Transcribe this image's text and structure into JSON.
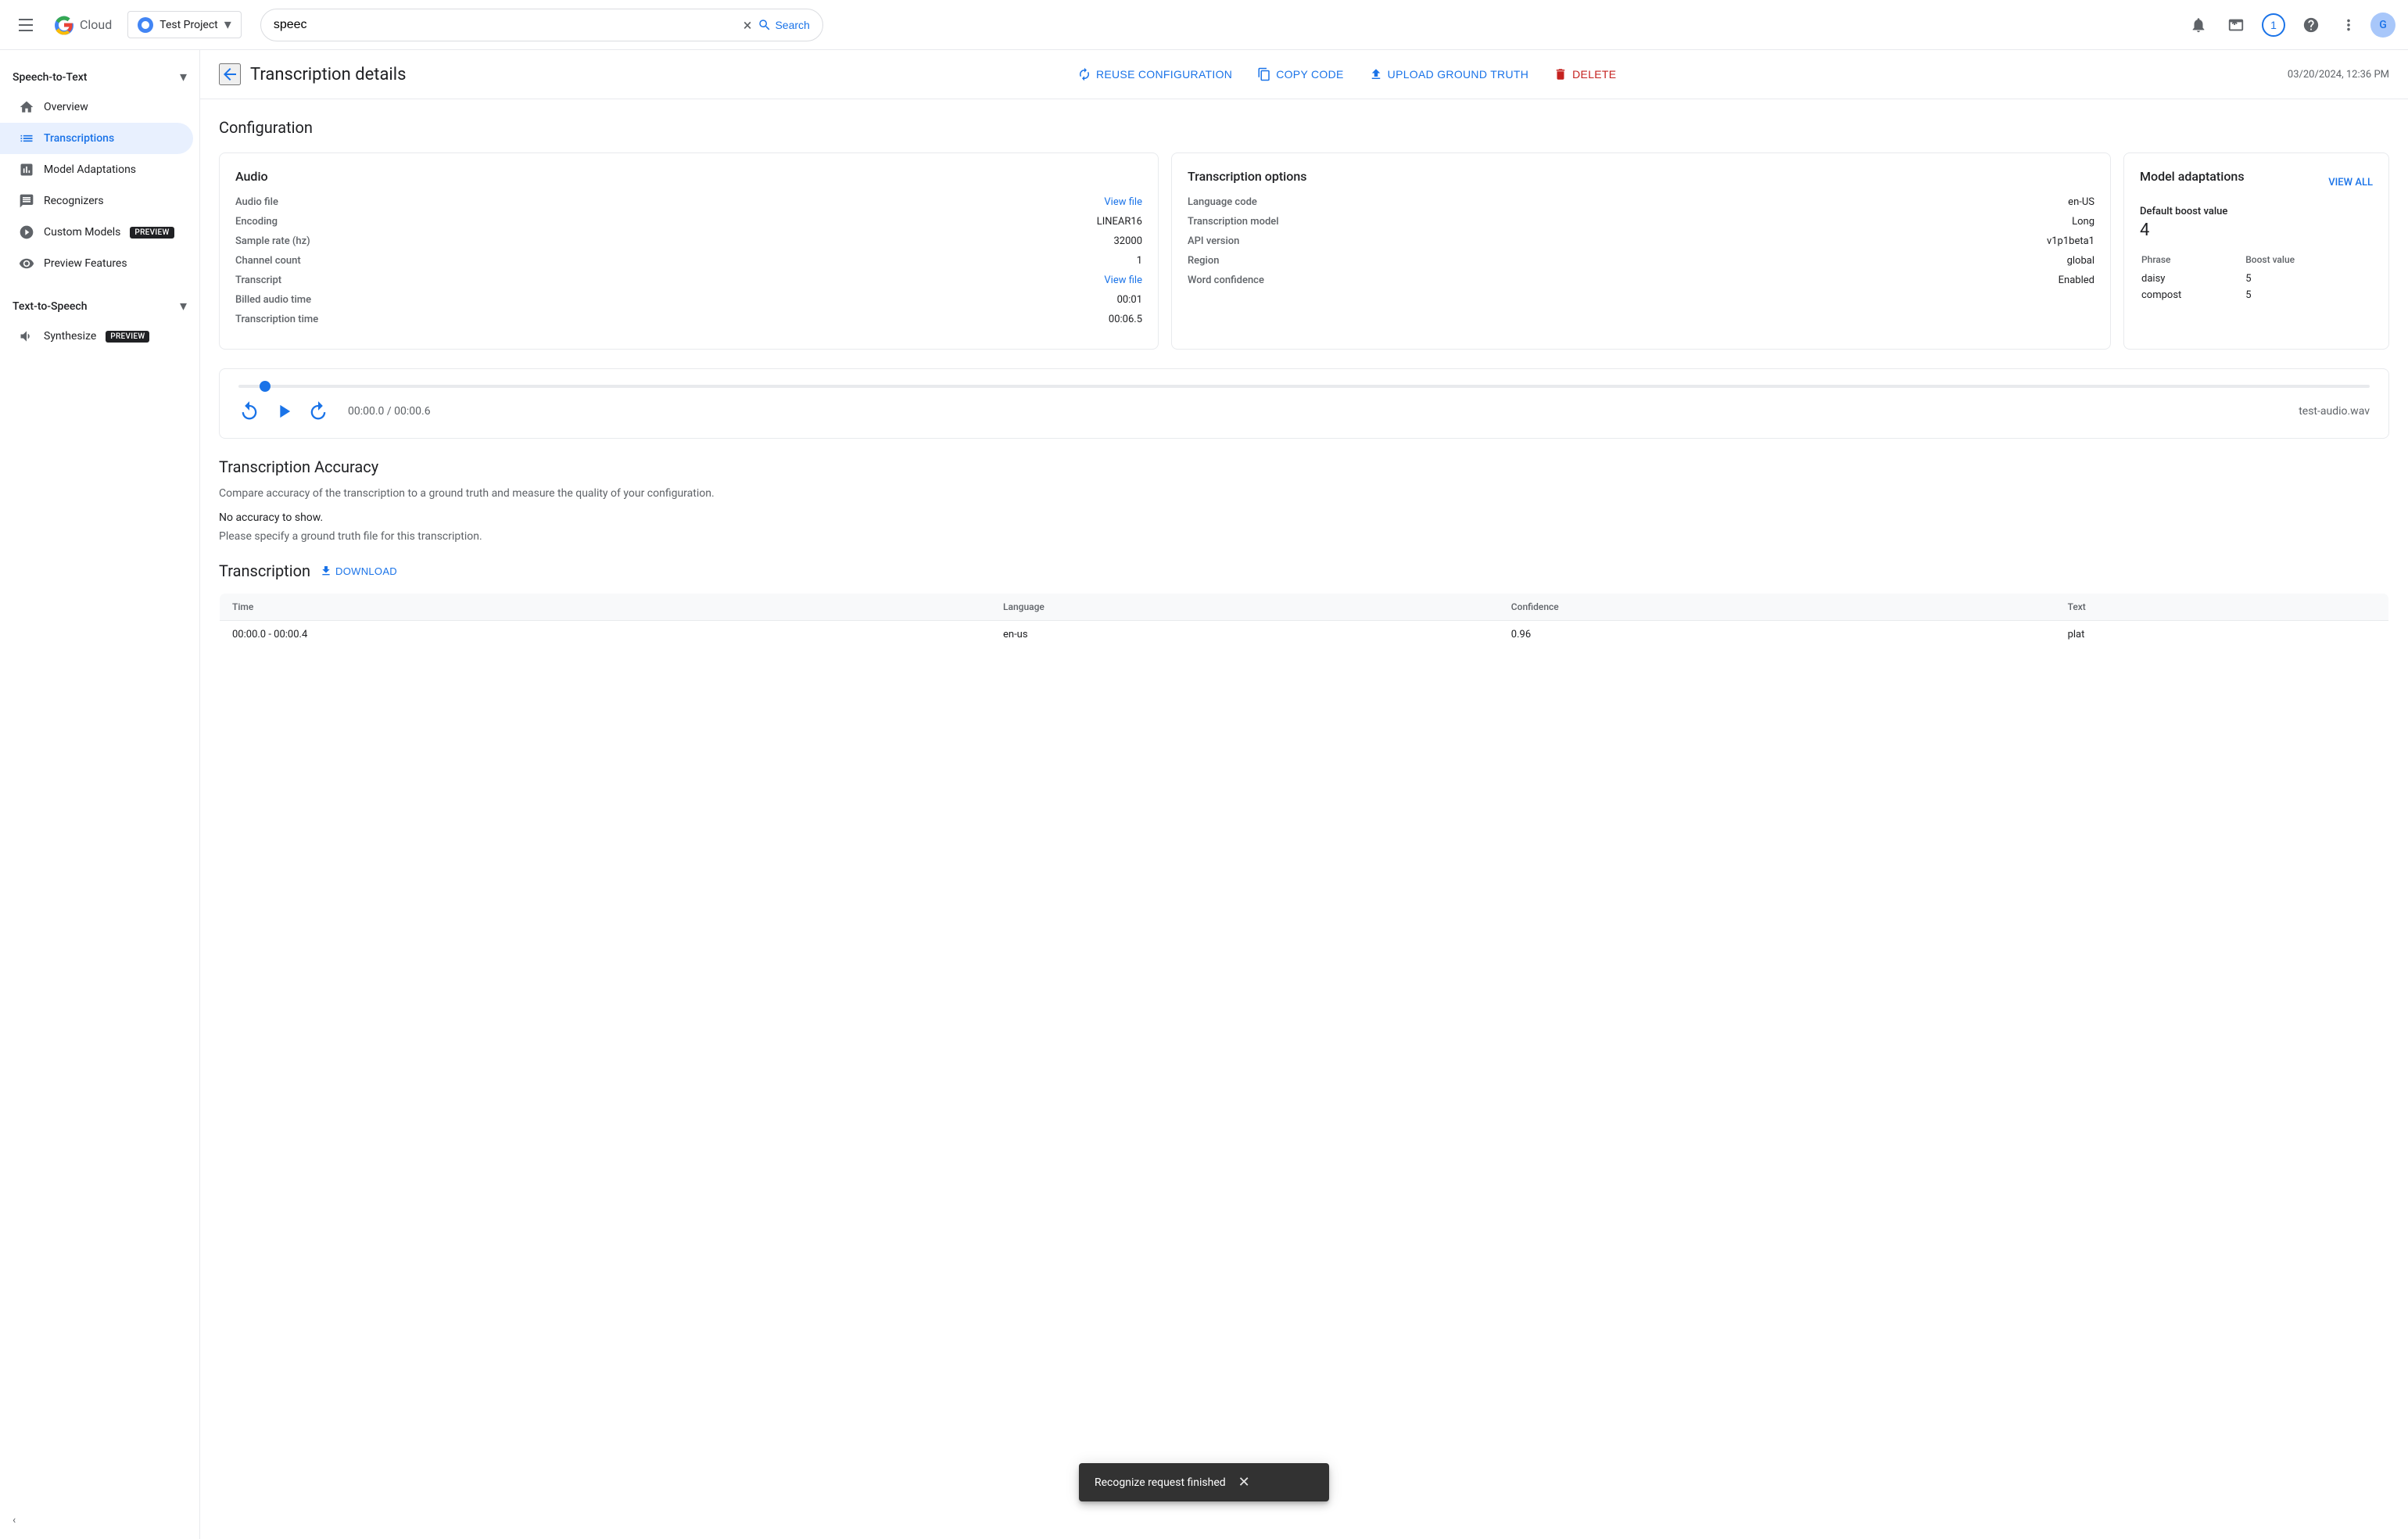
{
  "app": {
    "name": "Speech"
  },
  "nav": {
    "search_value": "speec",
    "search_placeholder": "Search",
    "project_name": "Test Project",
    "timestamp": "03/20/2024, 12:36 PM",
    "search_btn_label": "Search",
    "clear_label": "×",
    "account_initial": "G",
    "notification_count": "1"
  },
  "sidebar": {
    "speech_to_text_label": "Speech-to-Text",
    "text_to_speech_label": "Text-to-Speech",
    "items_stt": [
      {
        "id": "overview",
        "label": "Overview",
        "icon": "home"
      },
      {
        "id": "transcriptions",
        "label": "Transcriptions",
        "icon": "list",
        "active": true
      },
      {
        "id": "model-adaptations",
        "label": "Model Adaptations",
        "icon": "model"
      },
      {
        "id": "recognizers",
        "label": "Recognizers",
        "icon": "recognizer"
      },
      {
        "id": "custom-models",
        "label": "Custom Models",
        "icon": "custom",
        "badge": "PREVIEW"
      },
      {
        "id": "preview-features",
        "label": "Preview Features",
        "icon": "preview"
      }
    ],
    "items_tts": [
      {
        "id": "synthesize",
        "label": "Synthesize",
        "icon": "synthesize",
        "badge": "PREVIEW"
      }
    ],
    "collapse_label": "‹"
  },
  "page": {
    "title": "Transcription details",
    "back_label": "←",
    "actions": {
      "reuse_label": "REUSE CONFIGURATION",
      "copy_label": "COPY CODE",
      "upload_label": "UPLOAD GROUND TRUTH",
      "delete_label": "DELETE"
    }
  },
  "configuration": {
    "section_title": "Configuration",
    "audio_card": {
      "title": "Audio",
      "rows": [
        {
          "label": "Audio file",
          "value": "View file",
          "is_link": true
        },
        {
          "label": "Encoding",
          "value": "LINEAR16",
          "is_link": false
        },
        {
          "label": "Sample rate (hz)",
          "value": "32000",
          "is_link": false
        },
        {
          "label": "Channel count",
          "value": "1",
          "is_link": false
        },
        {
          "label": "Transcript",
          "value": "View file",
          "is_link": true
        },
        {
          "label": "Billed audio time",
          "value": "00:01",
          "is_link": false
        },
        {
          "label": "Transcription time",
          "value": "00:06.5",
          "is_link": false
        }
      ]
    },
    "transcription_options_card": {
      "title": "Transcription options",
      "rows": [
        {
          "label": "Language code",
          "value": "en-US"
        },
        {
          "label": "Transcription model",
          "value": "Long"
        },
        {
          "label": "API version",
          "value": "v1p1beta1"
        },
        {
          "label": "Region",
          "value": "global"
        },
        {
          "label": "Word confidence",
          "value": "Enabled"
        }
      ]
    },
    "model_adaptations_card": {
      "title": "Model adaptations",
      "view_all_label": "VIEW ALL",
      "default_boost_label": "Default boost value",
      "default_boost_value": "4",
      "phrases": [
        {
          "phrase": "daisy",
          "boost": "5"
        },
        {
          "phrase": "compost",
          "boost": "5"
        }
      ],
      "phrase_col": "Phrase",
      "boost_col": "Boost value"
    }
  },
  "audio_player": {
    "time_display": "00:00.0 / 00:00.6",
    "filename": "test-audio.wav",
    "progress_percent": 1
  },
  "accuracy": {
    "title": "Transcription Accuracy",
    "description": "Compare accuracy of the transcription to a ground truth and measure the quality of your configuration.",
    "no_data_label": "No accuracy to show.",
    "hint_label": "Please specify a ground truth file for this transcription."
  },
  "transcription": {
    "title": "Transcription",
    "download_label": "DOWNLOAD",
    "columns": [
      "Time",
      "Language",
      "Confidence",
      "Text"
    ],
    "rows": [
      {
        "time": "00:00.0 - 00:00.4",
        "language": "en-us",
        "confidence": "0.96",
        "text": "plat"
      }
    ]
  },
  "snackbar": {
    "message": "Recognize request finished",
    "close_label": "✕"
  }
}
